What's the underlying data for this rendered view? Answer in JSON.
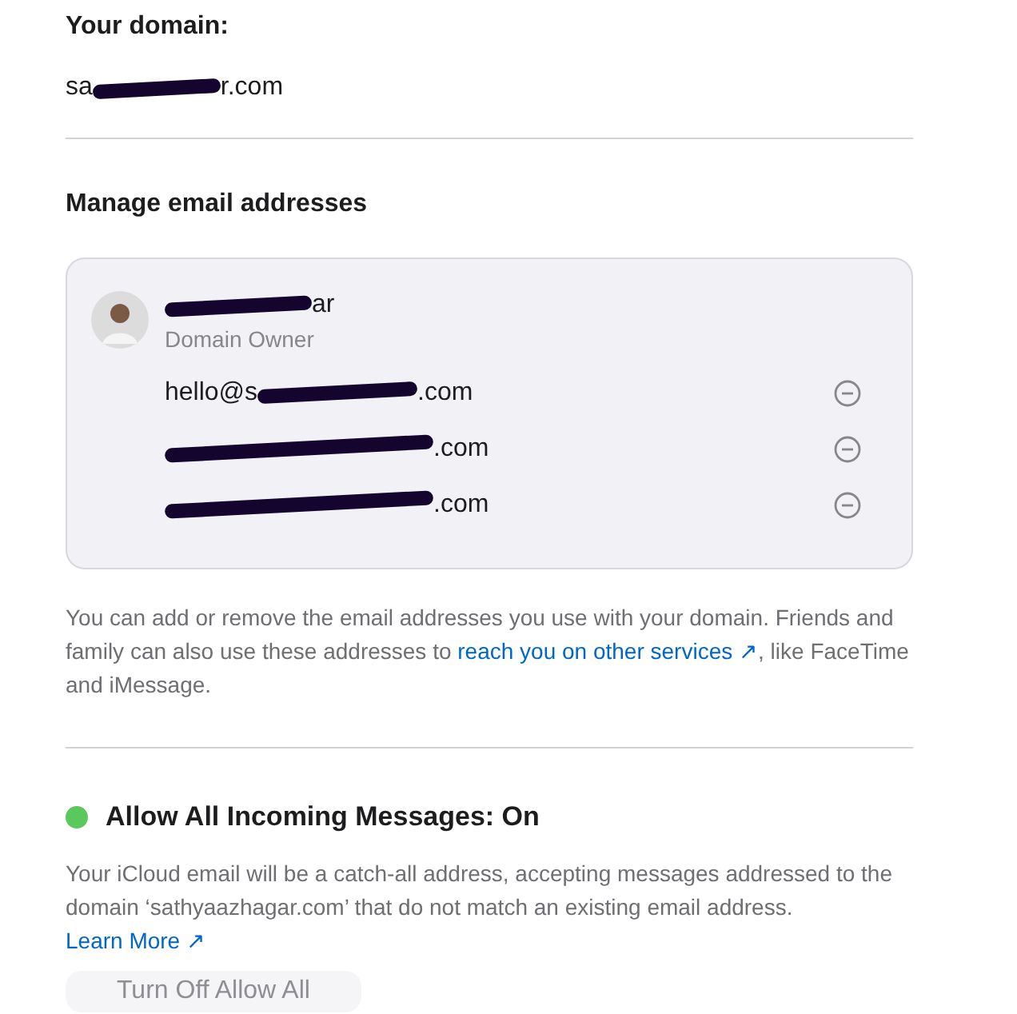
{
  "domain": {
    "heading": "Your domain:",
    "visible_start": "sa",
    "visible_end": "r.com"
  },
  "manage": {
    "heading": "Manage email addresses",
    "owner": {
      "name_visible_end": "ar",
      "role": "Domain Owner"
    },
    "addresses": [
      {
        "visible_start": "hello@s",
        "visible_end": ".com"
      },
      {
        "visible_end": ".com"
      },
      {
        "visible_end": ".com"
      }
    ],
    "note": {
      "before": "You can add or remove the email addresses you use with your domain. Friends and family can also use these addresses to ",
      "link": "reach you on other services ↗",
      "after": ", like FaceTime and iMessage."
    }
  },
  "catch_all": {
    "on": true,
    "heading": "Allow All Incoming Messages: On",
    "text": "Your iCloud email will be a catch-all address, accepting messages addressed to the domain ‘sathyaazhagar.com’ that do not match an existing email address. ",
    "link": "Learn More ↗",
    "button": "Turn Off Allow All"
  }
}
